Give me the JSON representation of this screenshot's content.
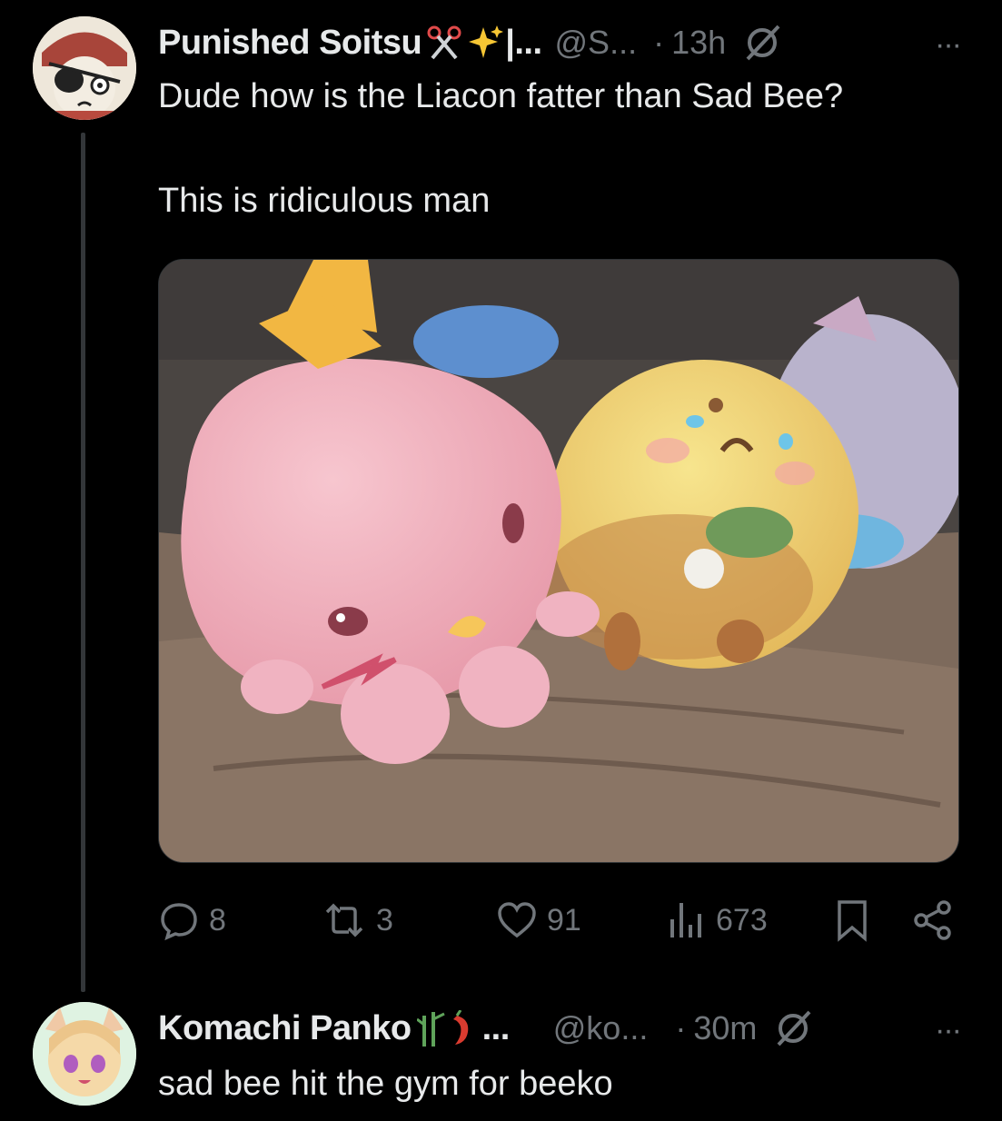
{
  "tweet1": {
    "display_name": "Punished Soitsu",
    "name_suffix": "|...",
    "handle": "@S...",
    "dot": "·",
    "time": "13h",
    "more": "···",
    "text_line1": "Dude how is the Liacon fatter than Sad Bee?",
    "text_line2": "This is ridiculous man",
    "actions": {
      "replies": "8",
      "reposts": "3",
      "likes": "91",
      "views": "673"
    }
  },
  "tweet2": {
    "display_name": "Komachi Panko",
    "name_suffix": "...",
    "handle": "@ko...",
    "dot": "·",
    "time": "30m",
    "more": "···",
    "text": "sad bee hit the gym for beeko"
  },
  "colors": {
    "background": "#000000",
    "text": "#e7e9ea",
    "muted": "#71767b"
  }
}
